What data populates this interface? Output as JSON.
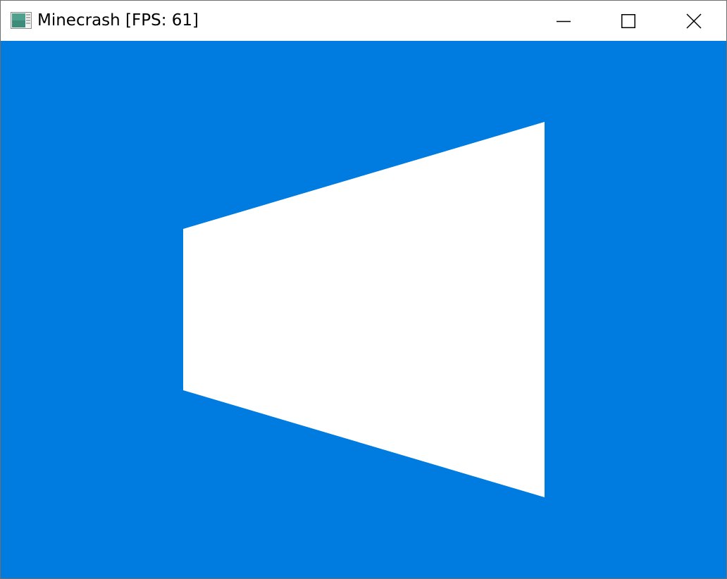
{
  "window": {
    "title": "Minecrash [FPS: 61]",
    "app_icon": "app-window-icon",
    "caption_buttons": {
      "minimize_icon": "minimize-icon",
      "maximize_icon": "maximize-icon",
      "close_icon": "close-icon"
    }
  },
  "viewport": {
    "background_color": "#007ce0",
    "shape_color": "#ffffff"
  }
}
